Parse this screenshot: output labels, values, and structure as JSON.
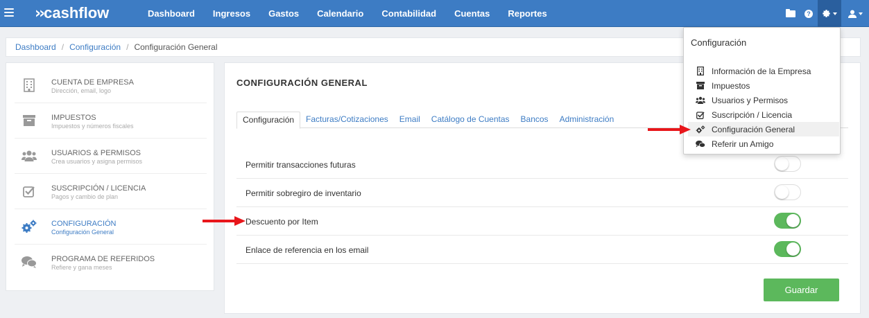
{
  "app": {
    "logo_text": "cashflow"
  },
  "nav": {
    "links": [
      "Dashboard",
      "Ingresos",
      "Gastos",
      "Calendario",
      "Contabilidad",
      "Cuentas",
      "Reportes"
    ]
  },
  "breadcrumb": {
    "items": [
      "Dashboard",
      "Configuración"
    ],
    "current": "Configuración General"
  },
  "sidebar": {
    "items": [
      {
        "title": "CUENTA DE EMPRESA",
        "subtitle": "Dirección, email, logo",
        "icon": "building-icon"
      },
      {
        "title": "IMPUESTOS",
        "subtitle": "Impuestos y números fiscales",
        "icon": "archive-icon"
      },
      {
        "title": "USUARIOS & PERMISOS",
        "subtitle": "Crea usuarios y asigna permisos",
        "icon": "users-icon"
      },
      {
        "title": "SUSCRIPCIÓN / LICENCIA",
        "subtitle": "Pagos y cambio de plan",
        "icon": "check-square-icon"
      },
      {
        "title": "CONFIGURACIÓN",
        "subtitle": "Configuración General",
        "icon": "gears-icon",
        "active": true
      },
      {
        "title": "PROGRAMA DE REFERIDOS",
        "subtitle": "Refiere y gana meses",
        "icon": "chat-icon"
      }
    ]
  },
  "main": {
    "title": "CONFIGURACIÓN GENERAL",
    "tabs": [
      "Configuración",
      "Facturas/Cotizaciones",
      "Email",
      "Catálogo de Cuentas",
      "Bancos",
      "Administración"
    ],
    "active_tab": 0,
    "settings": [
      {
        "label": "Permitir transacciones futuras",
        "enabled": false
      },
      {
        "label": "Permitir sobregiro de inventario",
        "enabled": false
      },
      {
        "label": "Descuento por Item",
        "enabled": true
      },
      {
        "label": "Enlace de referencia en los email",
        "enabled": true
      }
    ],
    "save_label": "Guardar"
  },
  "dropdown": {
    "header": "Configuración",
    "items": [
      {
        "label": "Información de la Empresa",
        "icon": "building-icon"
      },
      {
        "label": "Impuestos",
        "icon": "archive-icon"
      },
      {
        "label": "Usuarios y Permisos",
        "icon": "users-icon"
      },
      {
        "label": "Suscripción / Licencia",
        "icon": "check-square-icon"
      },
      {
        "label": "Configuración General",
        "icon": "gears-icon",
        "highlighted": true
      },
      {
        "label": "Referir un Amigo",
        "icon": "chat-icon"
      }
    ]
  },
  "colors": {
    "navbar": "#3d7cc4",
    "accent": "#3d7cc4",
    "success": "#5cb85c",
    "arrow": "#e8161b"
  }
}
